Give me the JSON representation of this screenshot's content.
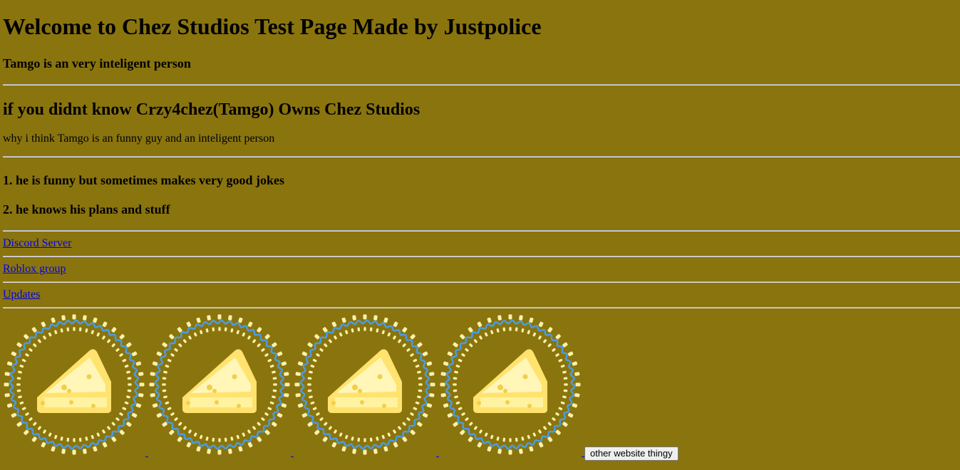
{
  "heading": "Welcome to Chez Studios Test Page Made by Justpolice",
  "subheading": "Tamgo is an very inteligent person",
  "owner_heading": "if you didnt know Crzy4chez(Tamgo) Owns Chez Studios",
  "why_text": "why i think Tamgo is an funny guy and an inteligent person",
  "reasons": [
    "1. he is funny but sometimes makes very good jokes",
    "2. he knows his plans and stuff"
  ],
  "links": {
    "discord": "Discord Server",
    "roblox": "Roblox group",
    "updates": "Updates"
  },
  "images": [
    {
      "icon": "cheese-logo-icon"
    },
    {
      "icon": "cheese-logo-icon"
    },
    {
      "icon": "cheese-logo-icon"
    },
    {
      "icon": "cheese-logo-icon"
    }
  ],
  "button_label": "other website thingy",
  "colors": {
    "background": "#8a740e",
    "link": "#0000ee",
    "cheese": "#ffe36e",
    "ring": "#4a9de0"
  }
}
